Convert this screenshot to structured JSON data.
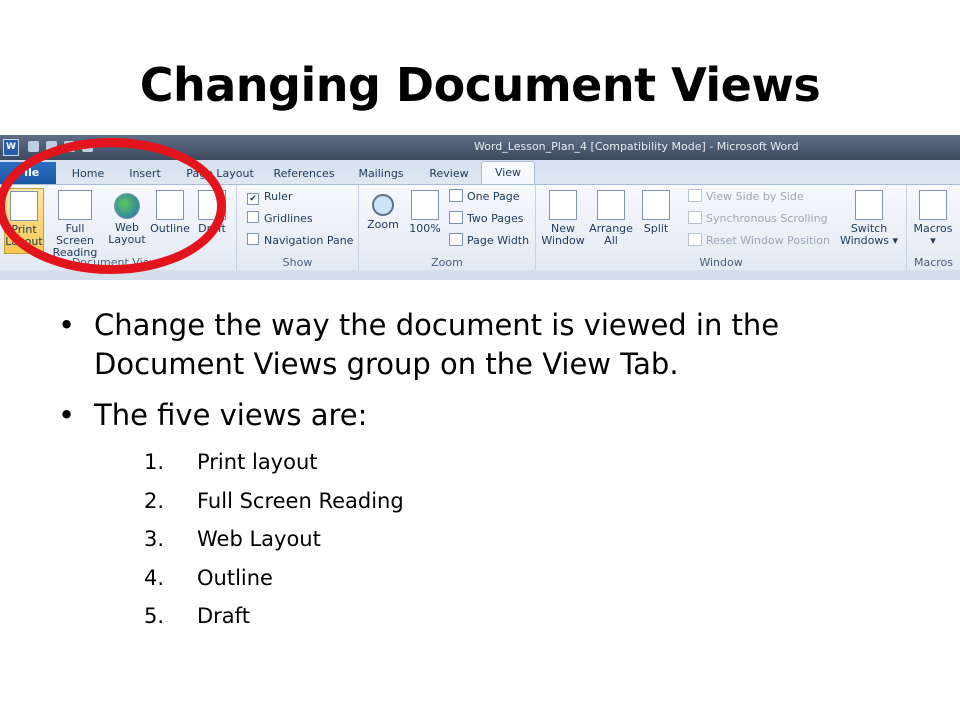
{
  "slide": {
    "title": "Changing Document Views",
    "bullets": [
      "Change the way the document is viewed in the Document Views group on the View Tab.",
      "The five views are:"
    ],
    "views": [
      {
        "num": "1.",
        "label": "Print layout"
      },
      {
        "num": "2.",
        "label": "Full Screen Reading"
      },
      {
        "num": "3.",
        "label": "Web Layout"
      },
      {
        "num": "4.",
        "label": "Outline"
      },
      {
        "num": "5.",
        "label": "Draft"
      }
    ]
  },
  "word_window": {
    "title": "Word_Lesson_Plan_4 [Compatibility Mode] - Microsoft Word",
    "tabs": {
      "file": "File",
      "home": "Home",
      "insert": "Insert",
      "page_layout": "Page Layout",
      "references": "References",
      "mailings": "Mailings",
      "review": "Review",
      "view": "View"
    },
    "groups": {
      "document_views": {
        "label": "Document Views",
        "print_layout": "Print Layout",
        "full_screen_reading": "Full Screen Reading",
        "web_layout": "Web Layout",
        "outline": "Outline",
        "draft": "Draft"
      },
      "show": {
        "label": "Show",
        "ruler": "Ruler",
        "gridlines": "Gridlines",
        "navigation_pane": "Navigation Pane"
      },
      "zoom": {
        "label": "Zoom",
        "zoom": "Zoom",
        "hundred": "100%",
        "one_page": "One Page",
        "two_pages": "Two Pages",
        "page_width": "Page Width"
      },
      "window": {
        "label": "Window",
        "new_window": "New Window",
        "arrange_all": "Arrange All",
        "split": "Split",
        "view_side_by_side": "View Side by Side",
        "synchronous_scrolling": "Synchronous Scrolling",
        "reset_window_position": "Reset Window Position",
        "switch_windows": "Switch Windows ▾"
      },
      "macros": {
        "label": "Macros",
        "macros": "Macros ▾"
      }
    },
    "colors": {
      "highlight": "#e3141c",
      "file_tab": "#1b55a4",
      "active_button": "#f8c950"
    }
  }
}
